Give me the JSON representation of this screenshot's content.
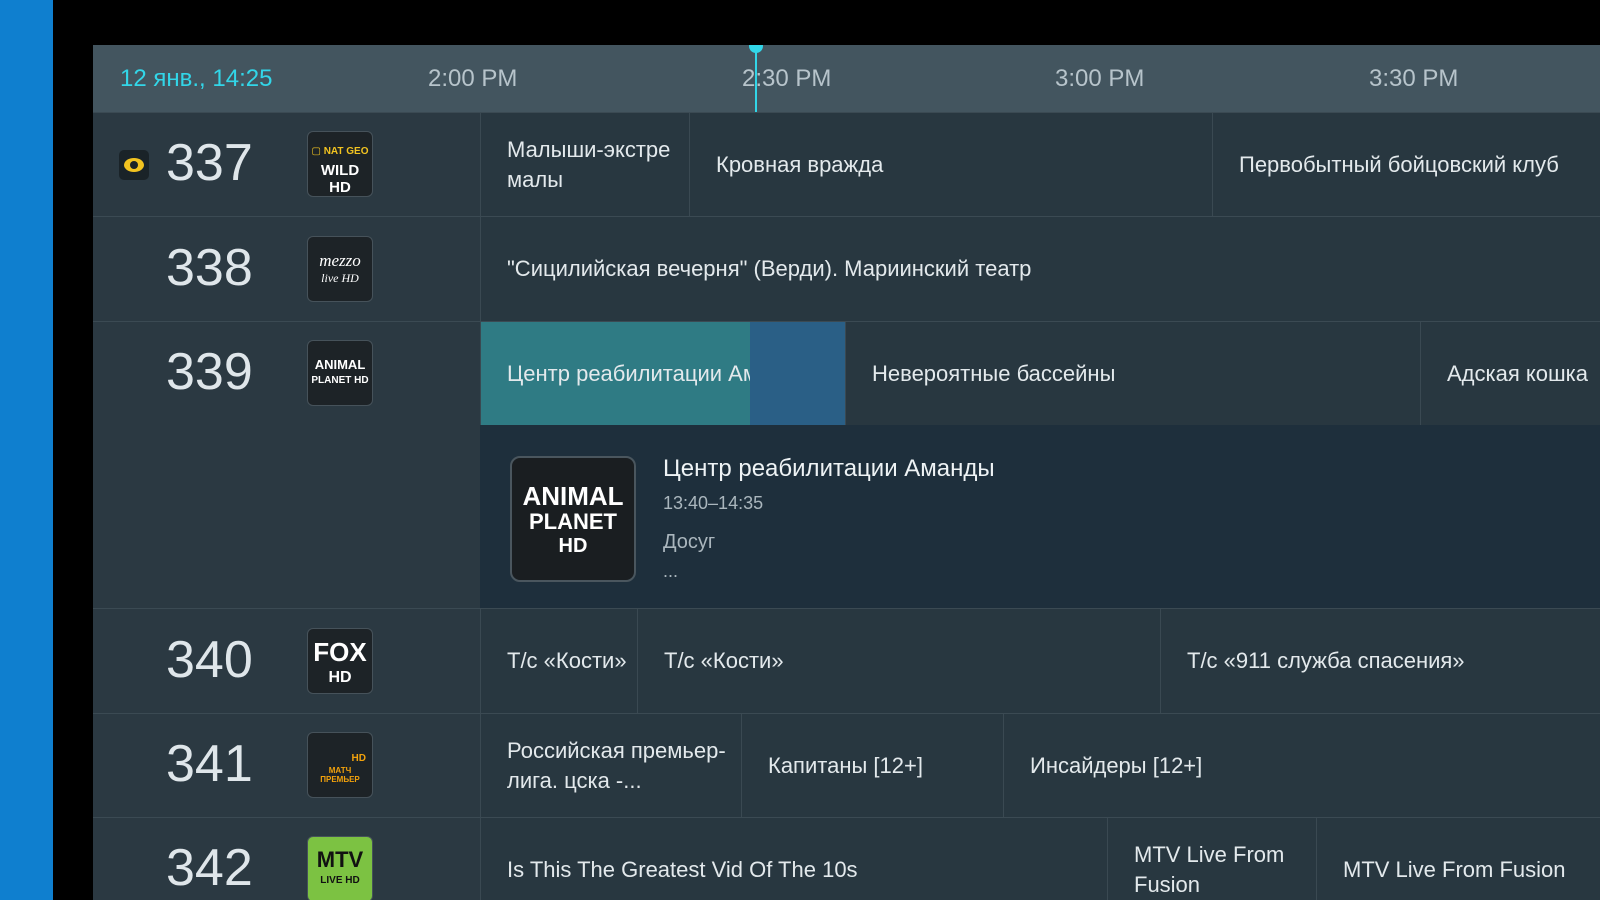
{
  "header": {
    "date_time": "12 янв., 14:25",
    "ticks": [
      "2:00 PM",
      "2:30 PM",
      "3:00 PM",
      "3:30 PM"
    ]
  },
  "colors": {
    "accent": "#32d6e8",
    "selected": "#2f7b84",
    "side_strip": "#0f7fcf"
  },
  "channels": [
    {
      "number": "337",
      "logo": {
        "name": "nat-geo-wild-logo",
        "line1": "▢ NAT GEO",
        "line2": "WILD HD"
      },
      "favorite": true,
      "programs": [
        "Малыши-экстре малы",
        "Кровная вражда",
        "Первобытный бойцовский клуб"
      ]
    },
    {
      "number": "338",
      "logo": {
        "name": "mezzo-live-logo",
        "line1": "mezzo",
        "line2": "live HD"
      },
      "programs": [
        "\"Сицилийская вечерня\" (Верди). Мариинский театр"
      ]
    },
    {
      "number": "339",
      "logo": {
        "name": "animal-planet-logo",
        "line1": "ANIMAL",
        "line2": "PLANET HD"
      },
      "programs": [
        "Центр реабилитации Аманды",
        "Невероятные бассейны",
        "Адская кошка"
      ]
    },
    {
      "number": "340",
      "logo": {
        "name": "fox-hd-logo",
        "line1": "FOX",
        "line2": "HD"
      },
      "programs": [
        "Т/с «Кости»",
        "Т/с «Кости»",
        "Т/с «911 служба спасения»"
      ]
    },
    {
      "number": "341",
      "logo": {
        "name": "match-premier-logo",
        "line1": "HD",
        "line2": "МАТЧ ПРЕМЬЕР"
      },
      "programs": [
        "Российская премьер-лига. цска -...",
        "Капитаны [12+]",
        "Инсайдеры [12+]"
      ]
    },
    {
      "number": "342",
      "logo": {
        "name": "mtv-live-logo",
        "line1": "MTV",
        "line2": "LIVE HD"
      },
      "programs": [
        "Is This The Greatest Vid Of The 10s",
        "MTV Live From Fusion",
        "MTV Live From Fusion"
      ]
    }
  ],
  "detail": {
    "logo_line1": "ANIMAL",
    "logo_line2": "PLANET",
    "logo_line3": "HD",
    "title": "Центр реабилитации Аманды",
    "time": "13:40–14:35",
    "genre": "Досуг",
    "more": "..."
  }
}
